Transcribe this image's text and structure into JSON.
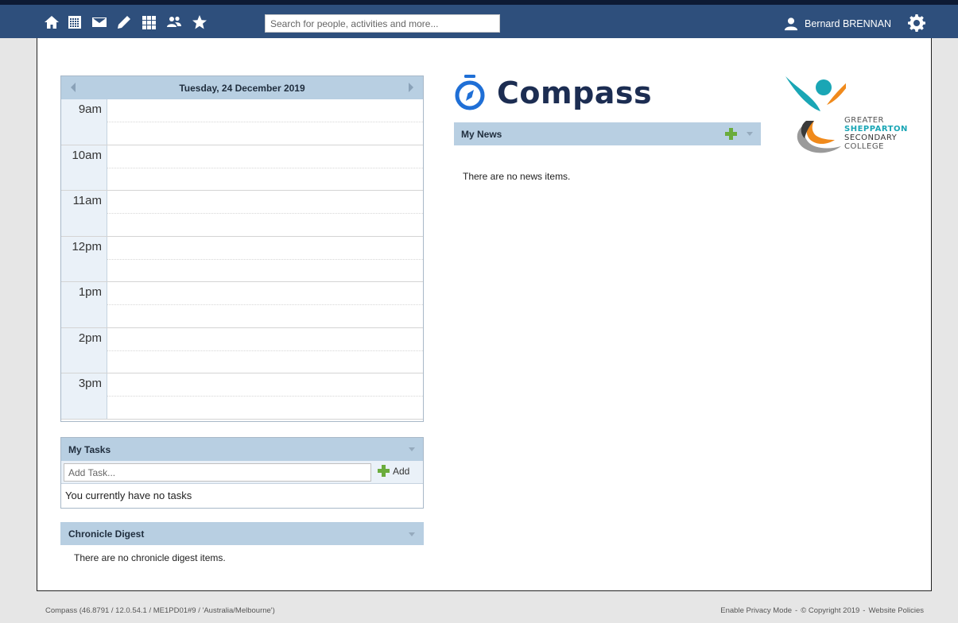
{
  "nav": {
    "icons": [
      "home-icon",
      "calendar-icon",
      "mail-icon",
      "pencil-icon",
      "grid-icon",
      "people-icon",
      "star-icon"
    ],
    "search_placeholder": "Search for people, activities and more...",
    "user_name": "Bernard BRENNAN"
  },
  "calendar": {
    "date": "Tuesday, 24 December 2019",
    "hours": [
      "9am",
      "10am",
      "11am",
      "12pm",
      "1pm",
      "2pm",
      "3pm"
    ]
  },
  "tasks": {
    "title": "My Tasks",
    "input_placeholder": "Add Task...",
    "add_label": "Add",
    "empty_message": "You currently have no tasks"
  },
  "chronicle": {
    "title": "Chronicle Digest",
    "empty_message": "There are no chronicle digest items."
  },
  "brand": {
    "name": "Compass",
    "school_line1": "GREATER",
    "school_line2": "SHEPPARTON",
    "school_line3": "SECONDARY",
    "school_line4": "COLLEGE"
  },
  "news": {
    "title": "My News",
    "empty_message": "There are no news items."
  },
  "footer": {
    "version": "Compass (46.8791 / 12.0.54.1 / ME1PD01#9 / 'Australia/Melbourne')",
    "privacy": "Enable Privacy Mode",
    "sep1": "-",
    "copyright": "© Copyright 2019",
    "sep2": "-",
    "policies": "Website Policies"
  },
  "colors": {
    "nav_bg": "#2e4f7c",
    "panel_header": "#b8cfe2",
    "accent_green": "#6aac3c",
    "brand_blue": "#1f6fd6"
  }
}
